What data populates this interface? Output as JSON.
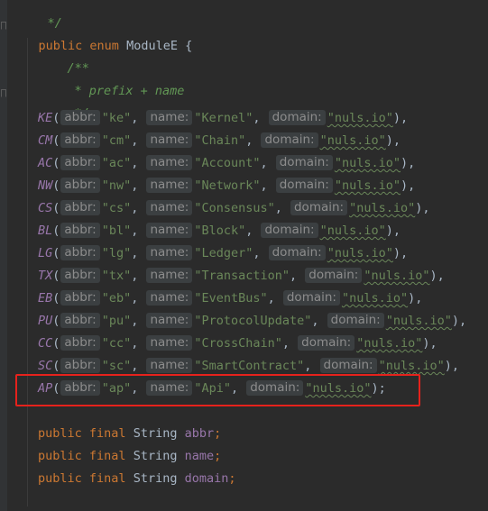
{
  "code": {
    "comment_close": "*/",
    "enum_decl": {
      "kw": "public enum",
      "name": "ModuleE",
      "brace": "{"
    },
    "doc_open": "/**",
    "doc_line": "* prefix + name",
    "doc_close": "*/",
    "hint_labels": {
      "abbr": "abbr:",
      "name": "name:",
      "domain": "domain:"
    },
    "constants": [
      {
        "id": "KE",
        "abbr": "\"ke\"",
        "name": "\"Kernel\"",
        "domain": "\"nuls.io\"",
        "end": "),"
      },
      {
        "id": "CM",
        "abbr": "\"cm\"",
        "name": "\"Chain\"",
        "domain": "\"nuls.io\"",
        "end": "),"
      },
      {
        "id": "AC",
        "abbr": "\"ac\"",
        "name": "\"Account\"",
        "domain": "\"nuls.io\"",
        "end": "),"
      },
      {
        "id": "NW",
        "abbr": "\"nw\"",
        "name": "\"Network\"",
        "domain": "\"nuls.io\"",
        "end": "),"
      },
      {
        "id": "CS",
        "abbr": "\"cs\"",
        "name": "\"Consensus\"",
        "domain": "\"nuls.io\"",
        "end": "),"
      },
      {
        "id": "BL",
        "abbr": "\"bl\"",
        "name": "\"Block\"",
        "domain": "\"nuls.io\"",
        "end": "),"
      },
      {
        "id": "LG",
        "abbr": "\"lg\"",
        "name": "\"Ledger\"",
        "domain": "\"nuls.io\"",
        "end": "),"
      },
      {
        "id": "TX",
        "abbr": "\"tx\"",
        "name": "\"Transaction\"",
        "domain": "\"nuls.io\"",
        "end": "),"
      },
      {
        "id": "EB",
        "abbr": "\"eb\"",
        "name": "\"EventBus\"",
        "domain": "\"nuls.io\"",
        "end": "),"
      },
      {
        "id": "PU",
        "abbr": "\"pu\"",
        "name": "\"ProtocolUpdate\"",
        "domain": "\"nuls.io\"",
        "end": "),"
      },
      {
        "id": "CC",
        "abbr": "\"cc\"",
        "name": "\"CrossChain\"",
        "domain": "\"nuls.io\"",
        "end": "),"
      },
      {
        "id": "SC",
        "abbr": "\"sc\"",
        "name": "\"SmartContract\"",
        "domain": "\"nuls.io\"",
        "end": "),"
      },
      {
        "id": "AP",
        "abbr": "\"ap\"",
        "name": "\"Api\"",
        "domain": "\"nuls.io\"",
        "end": ");"
      }
    ],
    "fields": [
      {
        "mods": "public final",
        "type": "String",
        "name": "abbr",
        "end": ";"
      },
      {
        "mods": "public final",
        "type": "String",
        "name": "name",
        "end": ";"
      },
      {
        "mods": "public final",
        "type": "String",
        "name": "domain",
        "end": ";"
      }
    ]
  },
  "colors": {
    "background": "#2b2b2b",
    "keyword": "#cc7832",
    "string": "#6a8759",
    "enum_constant": "#9876aa",
    "doc_comment": "#629755",
    "highlight_box": "#e6221c"
  }
}
